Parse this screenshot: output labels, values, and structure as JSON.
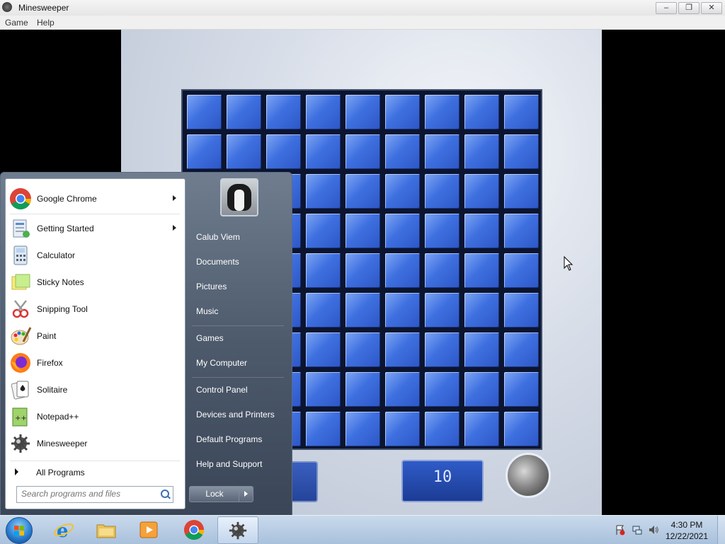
{
  "window": {
    "title": "Minesweeper",
    "menu": [
      "Game",
      "Help"
    ],
    "controls": {
      "minimize": "minimize",
      "maximize": "maximize",
      "close": "close"
    }
  },
  "game": {
    "grid": {
      "rows": 9,
      "cols": 9,
      "state": "all-covered"
    },
    "mine_counter": "10",
    "timer": ""
  },
  "start_menu": {
    "programs": [
      {
        "label": "Google Chrome",
        "icon": "chrome-icon",
        "has_submenu": true
      },
      {
        "label": "Getting Started",
        "icon": "getting-started-icon",
        "has_submenu": true
      },
      {
        "label": "Calculator",
        "icon": "calculator-icon",
        "has_submenu": false
      },
      {
        "label": "Sticky Notes",
        "icon": "sticky-notes-icon",
        "has_submenu": false
      },
      {
        "label": "Snipping Tool",
        "icon": "snipping-tool-icon",
        "has_submenu": false
      },
      {
        "label": "Paint",
        "icon": "paint-icon",
        "has_submenu": false
      },
      {
        "label": "Firefox",
        "icon": "firefox-icon",
        "has_submenu": false
      },
      {
        "label": "Solitaire",
        "icon": "solitaire-icon",
        "has_submenu": false
      },
      {
        "label": "Notepad++",
        "icon": "notepadpp-icon",
        "has_submenu": false
      },
      {
        "label": "Minesweeper",
        "icon": "minesweeper-icon",
        "has_submenu": false
      }
    ],
    "all_programs": "All Programs",
    "search_placeholder": "Search programs and files",
    "user_name": "Calub Viem",
    "right_items": [
      "Documents",
      "Pictures",
      "Music",
      "Games",
      "My Computer",
      "Control Panel",
      "Devices and Printers",
      "Default Programs",
      "Help and Support"
    ],
    "lock_button": "Lock"
  },
  "taskbar": {
    "pinned": [
      "internet-explorer-icon",
      "file-explorer-icon",
      "media-player-icon",
      "chrome-icon",
      "minesweeper-icon"
    ],
    "active": "minesweeper-icon",
    "tray_icons": [
      "action-center-flag-icon",
      "network-icon",
      "volume-icon"
    ],
    "clock": {
      "time": "4:30 PM",
      "date": "12/22/2021"
    }
  },
  "colors": {
    "tile_blue": "#3f70e0",
    "board_dark": "#0b1530",
    "start_menu_gray": "#4d5a6c",
    "taskbar": "#b9cde4"
  }
}
